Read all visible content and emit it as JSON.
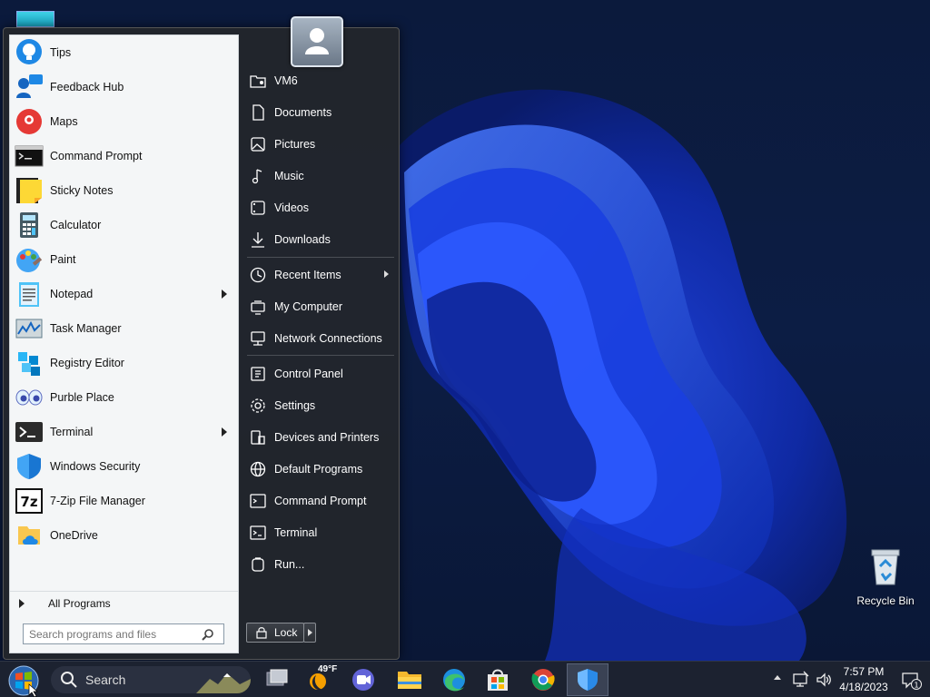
{
  "desktop": {
    "recycle_bin_label": "Recycle Bin"
  },
  "start_menu": {
    "programs": [
      {
        "label": "Tips",
        "icon": "tips-icon",
        "submenu": false
      },
      {
        "label": "Feedback Hub",
        "icon": "feedback-hub-icon",
        "submenu": false
      },
      {
        "label": "Maps",
        "icon": "maps-icon",
        "submenu": false
      },
      {
        "label": "Command Prompt",
        "icon": "command-prompt-icon",
        "submenu": false
      },
      {
        "label": "Sticky Notes",
        "icon": "sticky-notes-icon",
        "submenu": false
      },
      {
        "label": "Calculator",
        "icon": "calculator-icon",
        "submenu": false
      },
      {
        "label": "Paint",
        "icon": "paint-icon",
        "submenu": false
      },
      {
        "label": "Notepad",
        "icon": "notepad-icon",
        "submenu": true
      },
      {
        "label": "Task Manager",
        "icon": "task-manager-icon",
        "submenu": false
      },
      {
        "label": "Registry Editor",
        "icon": "registry-editor-icon",
        "submenu": false
      },
      {
        "label": "Purble Place",
        "icon": "purble-place-icon",
        "submenu": false
      },
      {
        "label": "Terminal",
        "icon": "terminal-icon",
        "submenu": true
      },
      {
        "label": "Windows Security",
        "icon": "windows-security-icon",
        "submenu": false
      },
      {
        "label": "7-Zip File Manager",
        "icon": "7zip-icon",
        "submenu": false
      },
      {
        "label": "OneDrive",
        "icon": "onedrive-icon",
        "submenu": false
      }
    ],
    "all_programs_label": "All Programs",
    "search_placeholder": "Search programs and files",
    "right_items": [
      {
        "label": "VM6",
        "icon": "user-folder-icon",
        "submenu": false
      },
      {
        "label": "Documents",
        "icon": "document-icon",
        "submenu": false
      },
      {
        "label": "Pictures",
        "icon": "picture-icon",
        "submenu": false
      },
      {
        "label": "Music",
        "icon": "music-note-icon",
        "submenu": false
      },
      {
        "label": "Videos",
        "icon": "video-icon",
        "submenu": false
      },
      {
        "label": "Downloads",
        "icon": "download-icon",
        "submenu": false
      },
      {
        "label": "Recent Items",
        "icon": "clock-icon",
        "submenu": true
      },
      {
        "label": "My Computer",
        "icon": "computer-icon",
        "submenu": false
      },
      {
        "label": "Network Connections",
        "icon": "network-icon",
        "submenu": false
      },
      {
        "label": "Control Panel",
        "icon": "control-panel-icon",
        "submenu": false
      },
      {
        "label": "Settings",
        "icon": "gear-icon",
        "submenu": false
      },
      {
        "label": "Devices and Printers",
        "icon": "printer-icon",
        "submenu": false
      },
      {
        "label": "Default Programs",
        "icon": "globe-icon",
        "submenu": false
      },
      {
        "label": "Command Prompt",
        "icon": "cmd-icon",
        "submenu": false
      },
      {
        "label": "Terminal",
        "icon": "terminal-small-icon",
        "submenu": false
      },
      {
        "label": "Run...",
        "icon": "run-icon",
        "submenu": false
      }
    ],
    "lock_label": "Lock"
  },
  "taskbar": {
    "search_label": "Search",
    "weather_temp": "49°F",
    "time": "7:57 PM",
    "date": "4/18/2023",
    "notification_count": "1"
  }
}
